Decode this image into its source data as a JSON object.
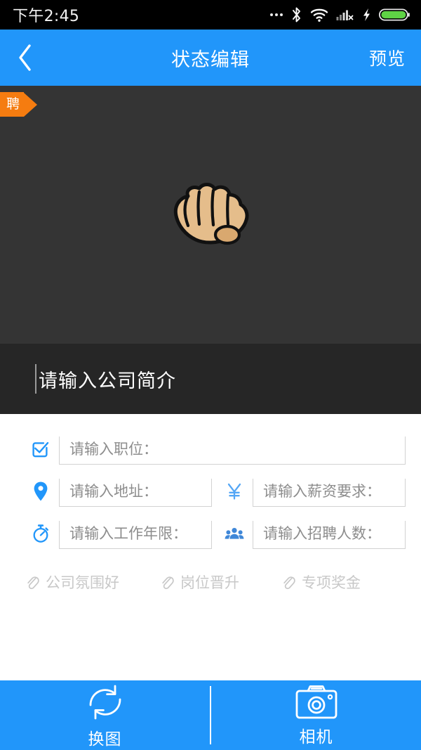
{
  "statusbar": {
    "time": "下午2:45",
    "icons": [
      "more-dots-icon",
      "bluetooth-icon",
      "wifi-icon",
      "cellular-signal-off-icon",
      "charging-bolt-icon",
      "battery-icon"
    ],
    "battery_color": "#5fd345",
    "background": "#000000"
  },
  "header": {
    "title": "状态编辑",
    "back_icon": "chevron-left-icon",
    "preview_label": "预览",
    "background": "#2196fa"
  },
  "photo": {
    "ribbon_label": "聘",
    "ribbon_color": "#f57c10",
    "background": "#343434",
    "image_name": "fist-bump-emoji",
    "image_skin_color": "#e5bd8b",
    "image_outline_color": "#111111"
  },
  "caption": {
    "placeholder": "请输入公司简介",
    "background": "#262626",
    "text_color": "#ffffff"
  },
  "form": {
    "rows": [
      {
        "fields": [
          {
            "icon": "check-circle-icon",
            "placeholder": "请输入职位：",
            "value": "",
            "icon_color": "#2196fa",
            "full_width": true
          }
        ]
      },
      {
        "fields": [
          {
            "icon": "map-pin-icon",
            "placeholder": "请输入地址：",
            "value": "",
            "icon_color": "#2196fa",
            "full_width": false
          },
          {
            "icon": "yuan-currency-icon",
            "placeholder": "请输入薪资要求：",
            "value": "",
            "icon_color": "#54a6f5",
            "full_width": false
          }
        ]
      },
      {
        "fields": [
          {
            "icon": "stopwatch-icon",
            "placeholder": "请输入工作年限：",
            "value": "",
            "icon_color": "#2196fa",
            "full_width": false
          },
          {
            "icon": "people-group-icon",
            "placeholder": "请输入招聘人数：",
            "value": "",
            "icon_color": "#3f87d8",
            "full_width": false
          }
        ]
      }
    ],
    "tags": [
      {
        "icon": "paperclip-icon",
        "label": "公司氛围好"
      },
      {
        "icon": "paperclip-icon",
        "label": "岗位晋升"
      },
      {
        "icon": "paperclip-icon",
        "label": "专项奖金"
      }
    ],
    "placeholder_color": "#8d8d8d",
    "tag_color": "#c8c8c8"
  },
  "bottombar": {
    "background": "#2196fa",
    "buttons": [
      {
        "icon": "refresh-cycle-icon",
        "label": "换图"
      },
      {
        "icon": "camera-icon",
        "label": "相机"
      }
    ]
  }
}
